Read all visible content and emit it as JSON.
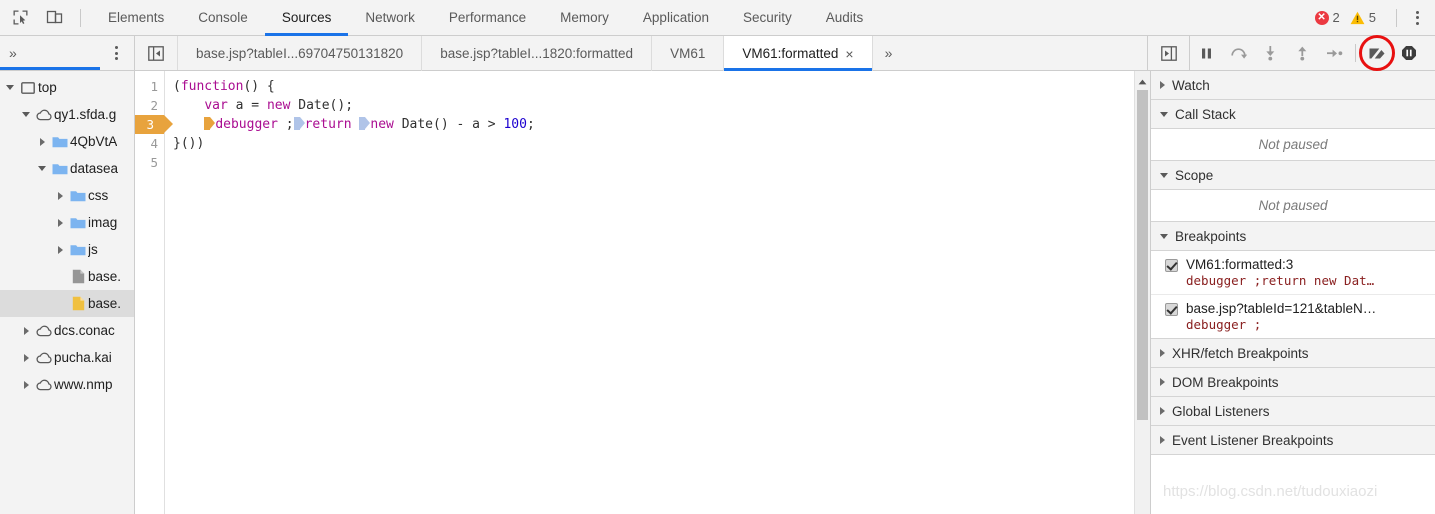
{
  "toolbar": {
    "inspect_icon": "inspect-element-icon",
    "device_icon": "device-toolbar-icon",
    "tabs": [
      {
        "label": "Elements",
        "active": false
      },
      {
        "label": "Console",
        "active": false
      },
      {
        "label": "Sources",
        "active": true
      },
      {
        "label": "Network",
        "active": false
      },
      {
        "label": "Performance",
        "active": false
      },
      {
        "label": "Memory",
        "active": false
      },
      {
        "label": "Application",
        "active": false
      },
      {
        "label": "Security",
        "active": false
      },
      {
        "label": "Audits",
        "active": false
      }
    ],
    "error_count": "2",
    "warning_count": "5",
    "error_icon": "error-circle-icon",
    "warning_icon": "warning-triangle-icon",
    "menu_icon": "more-options-icon",
    "colors": {
      "accent": "#1a73e8",
      "error": "#eb3941",
      "warning": "#fbbc04",
      "breakpoint": "#e8a33d",
      "annotation": "#e81010"
    }
  },
  "navigator": {
    "overflow_label": "»",
    "menu_icon": "navigator-more-options-icon",
    "tree": [
      {
        "label": "top",
        "icon": "frame-icon",
        "indent": 0,
        "twisty": "down",
        "selected": false
      },
      {
        "label": "qy1.sfda.g",
        "icon": "cloud-icon",
        "indent": 1,
        "twisty": "down",
        "selected": false
      },
      {
        "label": "4QbVtA",
        "icon": "folder-icon",
        "indent": 2,
        "twisty": "right",
        "selected": false
      },
      {
        "label": "datasea",
        "icon": "folder-icon",
        "indent": 2,
        "twisty": "down",
        "selected": false
      },
      {
        "label": "css",
        "icon": "folder-icon",
        "indent": 3,
        "twisty": "right",
        "selected": false
      },
      {
        "label": "imag",
        "icon": "folder-icon",
        "indent": 3,
        "twisty": "right",
        "selected": false
      },
      {
        "label": "js",
        "icon": "folder-icon",
        "indent": 3,
        "twisty": "right",
        "selected": false
      },
      {
        "label": "base.",
        "icon": "file-icon",
        "indent": 3,
        "twisty": "none",
        "selected": false
      },
      {
        "label": "base.",
        "icon": "script-file-icon",
        "indent": 3,
        "twisty": "none",
        "selected": true
      },
      {
        "label": "dcs.conac",
        "icon": "cloud-icon",
        "indent": 1,
        "twisty": "right",
        "selected": false
      },
      {
        "label": "pucha.kai",
        "icon": "cloud-icon",
        "indent": 1,
        "twisty": "right",
        "selected": false
      },
      {
        "label": "www.nmp",
        "icon": "cloud-icon",
        "indent": 1,
        "twisty": "right",
        "selected": false
      }
    ]
  },
  "editor": {
    "tabs_lead_icon": "show-navigator-icon",
    "tabs": [
      {
        "label": "base.jsp?tableI...69704750131820",
        "active": false,
        "closable": false
      },
      {
        "label": "base.jsp?tableI...1820:formatted",
        "active": false,
        "closable": false
      },
      {
        "label": "VM61",
        "active": false,
        "closable": false
      },
      {
        "label": "VM61:formatted",
        "active": true,
        "closable": true
      }
    ],
    "close_glyph": "×",
    "overflow_label": "»",
    "panel_toggle_icon": "show-debugger-sidebar-icon",
    "line_numbers": [
      "1",
      "2",
      "3",
      "4",
      "5"
    ],
    "breakpoint_line": "3",
    "code_lines": [
      "(function() {",
      "    var a = new Date();",
      "    debugger ;return new Date() - a > 100;",
      "}())",
      ""
    ]
  },
  "debugger_controls": [
    {
      "name": "pause-resume-script-button",
      "icon": "pause-icon"
    },
    {
      "name": "step-over-button",
      "icon": "step-over-icon"
    },
    {
      "name": "step-into-button",
      "icon": "step-into-icon"
    },
    {
      "name": "step-out-button",
      "icon": "step-out-icon"
    },
    {
      "name": "step-button",
      "icon": "step-icon"
    },
    {
      "name": "deactivate-breakpoints-button",
      "icon": "deactivate-breakpoints-icon",
      "annotated": true
    },
    {
      "name": "pause-on-exceptions-button",
      "icon": "pause-on-exceptions-icon"
    }
  ],
  "sidebar": {
    "sections": [
      {
        "title": "Watch",
        "expanded": false
      },
      {
        "title": "Call Stack",
        "expanded": true,
        "empty_text": "Not paused"
      },
      {
        "title": "Scope",
        "expanded": true,
        "empty_text": "Not paused"
      },
      {
        "title": "Breakpoints",
        "expanded": true
      },
      {
        "title": "XHR/fetch Breakpoints",
        "expanded": false
      },
      {
        "title": "DOM Breakpoints",
        "expanded": false
      },
      {
        "title": "Global Listeners",
        "expanded": false
      },
      {
        "title": "Event Listener Breakpoints",
        "expanded": false
      }
    ],
    "breakpoints": [
      {
        "location": "VM61:formatted:3",
        "snippet": "debugger ;return new Dat…",
        "checked": true
      },
      {
        "location": "base.jsp?tableId=121&tableN…",
        "snippet": "debugger ;",
        "checked": true
      }
    ],
    "watermark": "https://blog.csdn.net/tudouxiaozi"
  }
}
